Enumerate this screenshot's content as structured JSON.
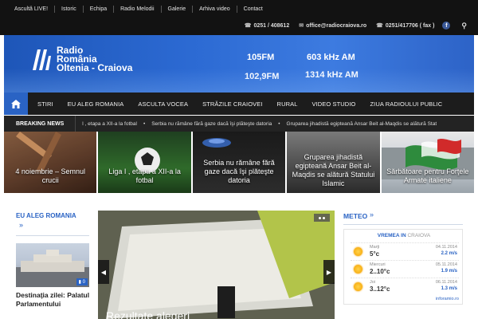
{
  "topnav": [
    "Ascultă LIVE!",
    "Istoric",
    "Echipa",
    "Radio Melodii",
    "Galerie",
    "Arhiva video",
    "Contact"
  ],
  "contacts": {
    "phone1": "0251 / 408612",
    "email": "office@radiocraiova.ro",
    "phone2": "0251/417706 ( fax )"
  },
  "logo": {
    "line1": "Radio",
    "line2": "România",
    "line3": "Oltenia - Craiova"
  },
  "frequencies": {
    "fm1": "105FM",
    "am1": "603 kHz AM",
    "fm2": "102,9FM",
    "am2": "1314 kHz AM"
  },
  "mainnav": [
    "STIRI",
    "EU ALEG ROMANIA",
    "ASCULTA VOCEA",
    "STRĂZILE CRAIOVEI",
    "RURAL",
    "VIDEO STUDIO",
    "ZIUA RADIOULUI PUBLIC"
  ],
  "breaking": {
    "label": "BREAKING NEWS",
    "items": [
      "l , etapa a XII-a la fotbal",
      "Serbia nu rămâne fără gaze dacă îşi plăteşte datoria",
      "Gruparea jihadistă egipteană Ansar Beit al-Maqdis se alătură Stat"
    ]
  },
  "tiles": [
    "4 noiembrie – Semnul crucii",
    "Liga I , etapa a XII-a la fotbal",
    "Serbia nu rămâne fără gaze dacă îşi plăteşte datoria",
    "Gruparea jihadistă egipteană Ansar Beit al-Maqdis se alătură Statului Islamic",
    "Sărbătoare pentru Forţele Armate italiene"
  ],
  "left": {
    "heading": "EU ALEG ROMANIA",
    "comments": "0",
    "title": "Destinaţia zilei: Palatul Parlamentului"
  },
  "slider": {
    "title": "Rezultate alegeri"
  },
  "meteo": {
    "heading": "METEO",
    "title_a": "VREMEA IN",
    "title_b": "CRAIOVA",
    "rows": [
      {
        "day": "Marţi",
        "temp": "5°c",
        "date": "04.11.2014",
        "wind": "2.2 m/s"
      },
      {
        "day": "Miercuri",
        "temp": "2..10°c",
        "date": "05.11.2014",
        "wind": "1.9 m/s"
      },
      {
        "day": "Joi",
        "temp": "3..12°c",
        "date": "06.11.2014",
        "wind": "1.3 m/s"
      }
    ],
    "source": "inforamio.ro"
  },
  "colors": {
    "accent": "#2a63c4",
    "dark": "#121212"
  }
}
